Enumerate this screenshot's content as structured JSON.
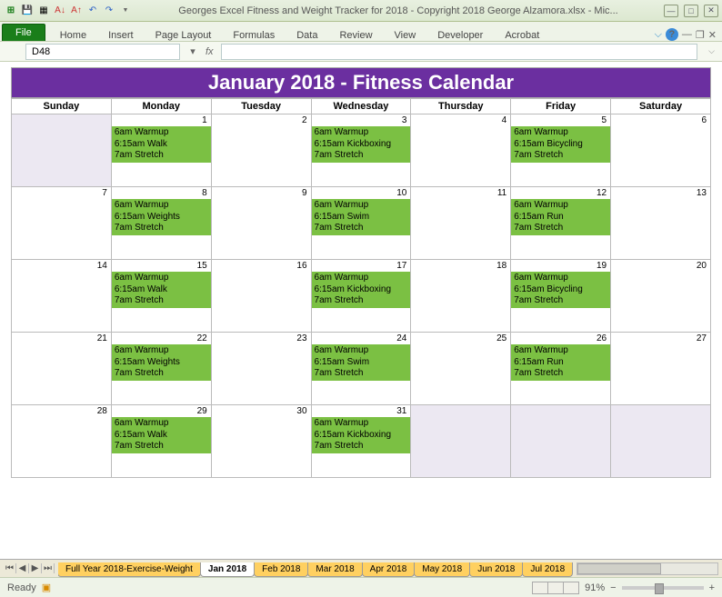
{
  "window": {
    "title": "Georges Excel Fitness and Weight Tracker for 2018 - Copyright 2018 George Alzamora.xlsx  -  Mic..."
  },
  "ribbon": {
    "file": "File",
    "tabs": [
      "Home",
      "Insert",
      "Page Layout",
      "Formulas",
      "Data",
      "Review",
      "View",
      "Developer",
      "Acrobat"
    ]
  },
  "namebox": "D48",
  "fx_label": "fx",
  "calendar": {
    "title": "January 2018  -  Fitness Calendar",
    "days": [
      "Sunday",
      "Monday",
      "Tuesday",
      "Wednesday",
      "Thursday",
      "Friday",
      "Saturday"
    ],
    "rows": [
      [
        {
          "n": "",
          "grey": true
        },
        {
          "n": "1",
          "e": [
            "6am Warmup",
            "6:15am Walk",
            "7am Stretch"
          ]
        },
        {
          "n": "2"
        },
        {
          "n": "3",
          "e": [
            "6am Warmup",
            "6:15am Kickboxing",
            "7am Stretch"
          ]
        },
        {
          "n": "4"
        },
        {
          "n": "5",
          "e": [
            "6am Warmup",
            "6:15am Bicycling",
            "7am Stretch"
          ]
        },
        {
          "n": "6"
        }
      ],
      [
        {
          "n": "7"
        },
        {
          "n": "8",
          "e": [
            "6am Warmup",
            "6:15am Weights",
            "7am Stretch"
          ]
        },
        {
          "n": "9"
        },
        {
          "n": "10",
          "e": [
            "6am Warmup",
            "6:15am Swim",
            "7am Stretch"
          ]
        },
        {
          "n": "11"
        },
        {
          "n": "12",
          "e": [
            "6am Warmup",
            "6:15am Run",
            "7am Stretch"
          ]
        },
        {
          "n": "13"
        }
      ],
      [
        {
          "n": "14"
        },
        {
          "n": "15",
          "e": [
            "6am Warmup",
            "6:15am Walk",
            "7am Stretch"
          ]
        },
        {
          "n": "16"
        },
        {
          "n": "17",
          "e": [
            "6am Warmup",
            "6:15am Kickboxing",
            "7am Stretch"
          ]
        },
        {
          "n": "18"
        },
        {
          "n": "19",
          "e": [
            "6am Warmup",
            "6:15am Bicycling",
            "7am Stretch"
          ]
        },
        {
          "n": "20"
        }
      ],
      [
        {
          "n": "21"
        },
        {
          "n": "22",
          "e": [
            "6am Warmup",
            "6:15am Weights",
            "7am Stretch"
          ]
        },
        {
          "n": "23"
        },
        {
          "n": "24",
          "e": [
            "6am Warmup",
            "6:15am Swim",
            "7am Stretch"
          ]
        },
        {
          "n": "25"
        },
        {
          "n": "26",
          "e": [
            "6am Warmup",
            "6:15am Run",
            "7am Stretch"
          ]
        },
        {
          "n": "27"
        }
      ],
      [
        {
          "n": "28"
        },
        {
          "n": "29",
          "e": [
            "6am Warmup",
            "6:15am Walk",
            "7am Stretch"
          ]
        },
        {
          "n": "30"
        },
        {
          "n": "31",
          "e": [
            "6am Warmup",
            "6:15am Kickboxing",
            "7am Stretch"
          ]
        },
        {
          "n": "",
          "grey": true
        },
        {
          "n": "",
          "grey": true
        },
        {
          "n": "",
          "grey": true
        }
      ]
    ]
  },
  "sheets": {
    "tabs": [
      "Full Year 2018-Exercise-Weight",
      "Jan 2018",
      "Feb 2018",
      "Mar 2018",
      "Apr 2018",
      "May 2018",
      "Jun 2018",
      "Jul 2018"
    ],
    "active": 1
  },
  "status": {
    "ready": "Ready",
    "zoom": "91%"
  }
}
